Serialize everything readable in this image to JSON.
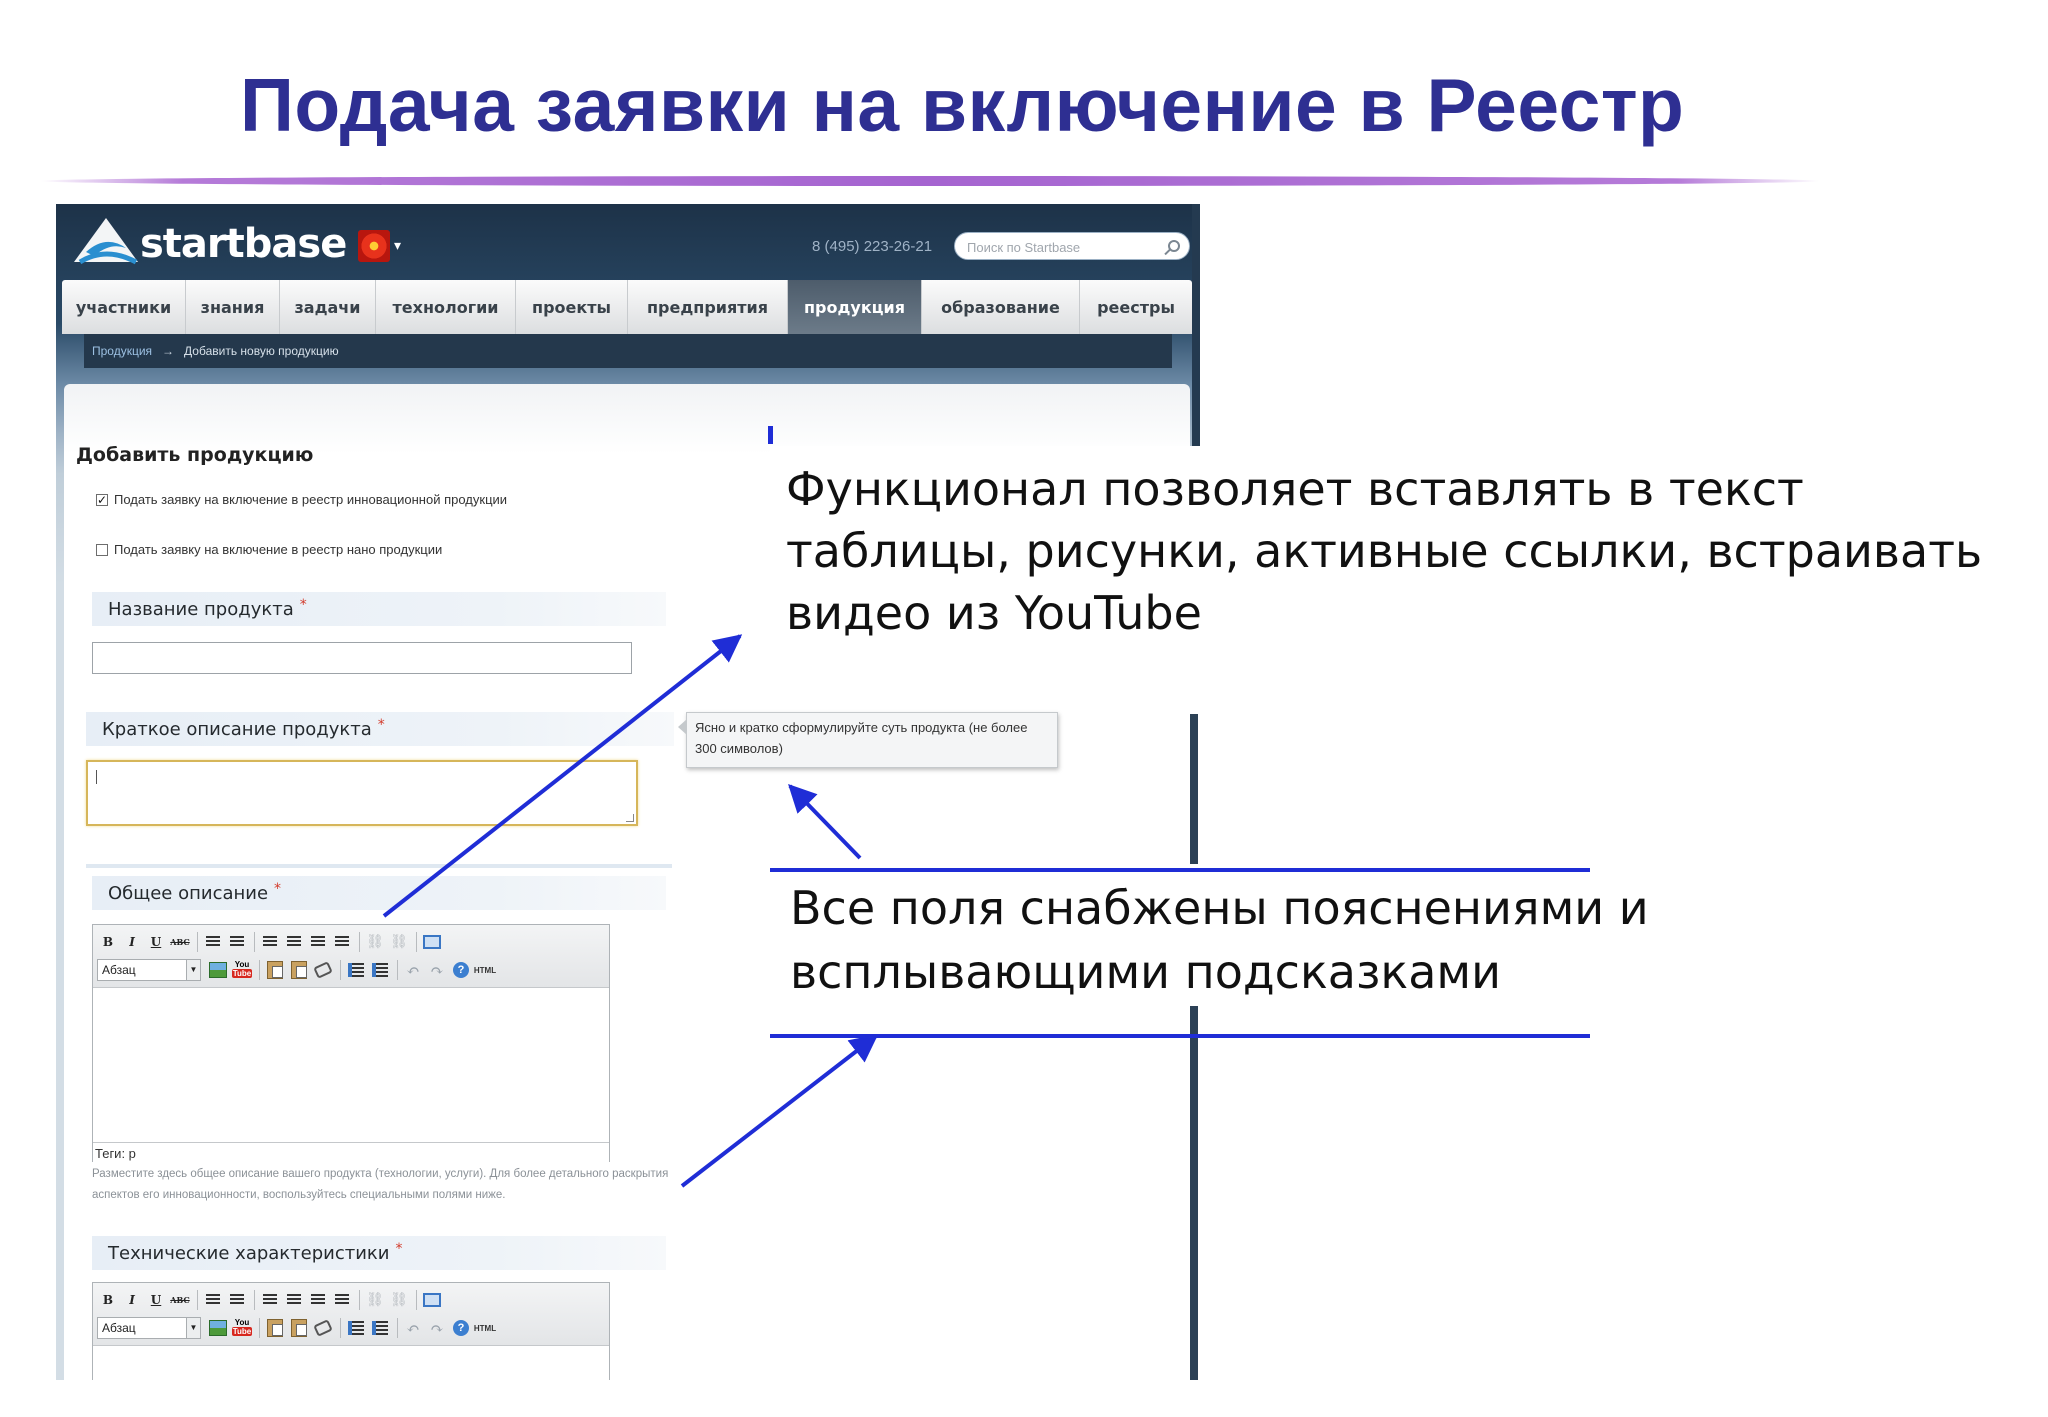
{
  "slide": {
    "title": "Подача заявки на включение в Реестр"
  },
  "site": {
    "logo_text": "startbase",
    "phone": "8 (495) 223-26-21",
    "search_placeholder": "Поиск по Startbase",
    "nav": [
      {
        "label": "участники",
        "active": false
      },
      {
        "label": "знания",
        "active": false
      },
      {
        "label": "задачи",
        "active": false
      },
      {
        "label": "технологии",
        "active": false
      },
      {
        "label": "проекты",
        "active": false
      },
      {
        "label": "предприятия",
        "active": false
      },
      {
        "label": "продукция",
        "active": true
      },
      {
        "label": "образование",
        "active": false
      },
      {
        "label": "реестры",
        "active": false
      }
    ],
    "breadcrumb": {
      "parent": "Продукция",
      "separator": "→",
      "current": "Добавить новую продукцию"
    }
  },
  "form": {
    "title": "Добавить продукцию",
    "checkbox_innovation": {
      "label": "Подать заявку на включение в реестр инновационной продукции",
      "checked": true
    },
    "checkbox_nano": {
      "label": "Подать заявку на включение в реестр нано продукции",
      "checked": false
    },
    "required_mark": "*",
    "name_label": "Название продукта",
    "name_value": "",
    "short_label": "Краткое описание продукта",
    "short_value": "",
    "short_tooltip": "Ясно и кратко сформулируйте суть продукта (не более 300 символов)",
    "general_label": "Общее описание",
    "general_help": "Разместите здесь общее описание вашего продукта (технологии, услуги). Для более детального раскрытия аспектов его инновационности, воспользуйтесь специальными полями ниже.",
    "tech_label": "Технические характеристики",
    "editor": {
      "format_select": "Абзац",
      "status_path": "Теги: p",
      "bold": "B",
      "italic": "I",
      "underline": "U",
      "strike": "ABC",
      "youtube_top": "You",
      "youtube_bottom": "Tube",
      "html": "HTML",
      "help": "?"
    }
  },
  "callouts": {
    "functionality": "Функционал позволяет вставлять в текст таблицы, рисунки, активные ссылки, встраивать видео из YouTube",
    "hints": "Все поля снабжены пояснениями и всплывающими подсказками"
  },
  "colors": {
    "title": "#2e2f92",
    "arrow": "#1f2dd6",
    "nav_active": "#5c6b7a"
  }
}
